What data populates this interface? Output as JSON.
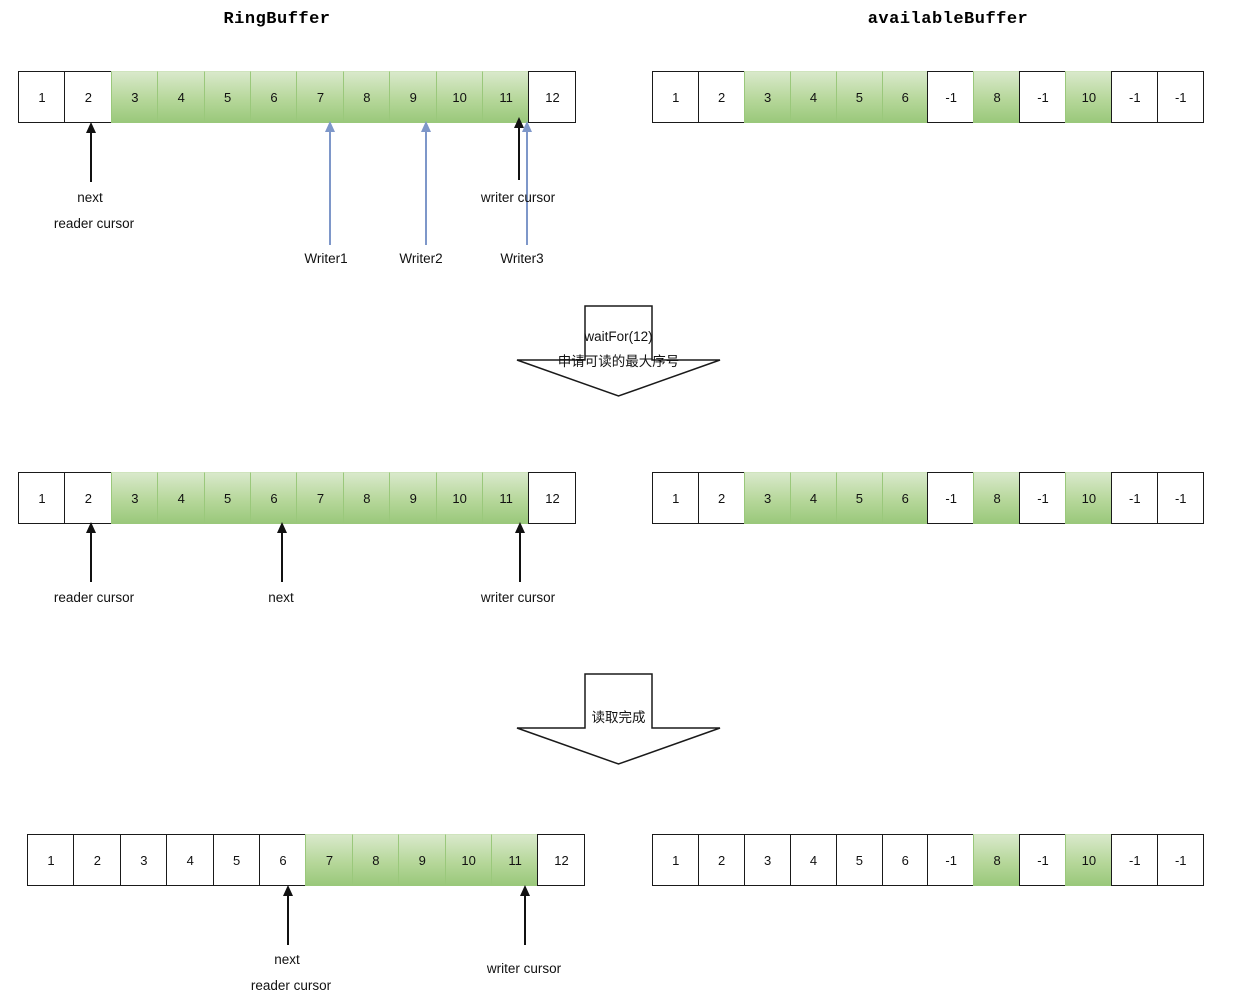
{
  "titles": {
    "ring_buffer": "RingBuffer",
    "available_buffer": "availableBuffer"
  },
  "colors": {
    "filled_cell_top": "#d9e9cb",
    "filled_cell_bottom": "#9ac87b",
    "cell_border": "#1a1a1a",
    "writer_arrow": "#7e97c9",
    "cursor_arrow": "#111111",
    "background": "#ffffff"
  },
  "stages": [
    {
      "id": "stage-1",
      "ring_buffer": {
        "cells": [
          {
            "value": "1",
            "filled": false
          },
          {
            "value": "2",
            "filled": false
          },
          {
            "value": "3",
            "filled": true
          },
          {
            "value": "4",
            "filled": true
          },
          {
            "value": "5",
            "filled": true
          },
          {
            "value": "6",
            "filled": true
          },
          {
            "value": "7",
            "filled": true
          },
          {
            "value": "8",
            "filled": true
          },
          {
            "value": "9",
            "filled": true
          },
          {
            "value": "10",
            "filled": true
          },
          {
            "value": "11",
            "filled": true
          },
          {
            "value": "12",
            "filled": false
          }
        ]
      },
      "available_buffer": {
        "cells": [
          {
            "value": "1",
            "filled": false
          },
          {
            "value": "2",
            "filled": false
          },
          {
            "value": "3",
            "filled": true
          },
          {
            "value": "4",
            "filled": true
          },
          {
            "value": "5",
            "filled": true
          },
          {
            "value": "6",
            "filled": true
          },
          {
            "value": "-1",
            "filled": false
          },
          {
            "value": "8",
            "filled": true
          },
          {
            "value": "-1",
            "filled": false
          },
          {
            "value": "10",
            "filled": true
          },
          {
            "value": "-1",
            "filled": false
          },
          {
            "value": "-1",
            "filled": false
          }
        ]
      },
      "annotations": [
        {
          "name": "next",
          "text": "next",
          "cell_index": 1,
          "kind": "cursor"
        },
        {
          "name": "reader-cursor",
          "text": "reader cursor",
          "cell_index": 1,
          "kind": "cursor"
        },
        {
          "name": "writer-cursor",
          "text": "writer cursor",
          "cell_index": 10,
          "kind": "cursor"
        },
        {
          "name": "writer1",
          "text": "Writer1",
          "cell_index": 6,
          "kind": "writer"
        },
        {
          "name": "writer2",
          "text": "Writer2",
          "cell_index": 8,
          "kind": "writer"
        },
        {
          "name": "writer3",
          "text": "Writer3",
          "cell_index": 10,
          "kind": "writer"
        }
      ]
    },
    {
      "id": "stage-2",
      "ring_buffer": {
        "cells": [
          {
            "value": "1",
            "filled": false
          },
          {
            "value": "2",
            "filled": false
          },
          {
            "value": "3",
            "filled": true
          },
          {
            "value": "4",
            "filled": true
          },
          {
            "value": "5",
            "filled": true
          },
          {
            "value": "6",
            "filled": true
          },
          {
            "value": "7",
            "filled": true
          },
          {
            "value": "8",
            "filled": true
          },
          {
            "value": "9",
            "filled": true
          },
          {
            "value": "10",
            "filled": true
          },
          {
            "value": "11",
            "filled": true
          },
          {
            "value": "12",
            "filled": false
          }
        ]
      },
      "available_buffer": {
        "cells": [
          {
            "value": "1",
            "filled": false
          },
          {
            "value": "2",
            "filled": false
          },
          {
            "value": "3",
            "filled": true
          },
          {
            "value": "4",
            "filled": true
          },
          {
            "value": "5",
            "filled": true
          },
          {
            "value": "6",
            "filled": true
          },
          {
            "value": "-1",
            "filled": false
          },
          {
            "value": "8",
            "filled": true
          },
          {
            "value": "-1",
            "filled": false
          },
          {
            "value": "10",
            "filled": true
          },
          {
            "value": "-1",
            "filled": false
          },
          {
            "value": "-1",
            "filled": false
          }
        ]
      },
      "annotations": [
        {
          "name": "reader-cursor",
          "text": "reader cursor",
          "cell_index": 1,
          "kind": "cursor"
        },
        {
          "name": "next",
          "text": "next",
          "cell_index": 5,
          "kind": "cursor"
        },
        {
          "name": "writer-cursor",
          "text": "writer cursor",
          "cell_index": 10,
          "kind": "cursor"
        }
      ]
    },
    {
      "id": "stage-3",
      "ring_buffer": {
        "cells": [
          {
            "value": "1",
            "filled": false
          },
          {
            "value": "2",
            "filled": false
          },
          {
            "value": "3",
            "filled": false
          },
          {
            "value": "4",
            "filled": false
          },
          {
            "value": "5",
            "filled": false
          },
          {
            "value": "6",
            "filled": false
          },
          {
            "value": "7",
            "filled": true
          },
          {
            "value": "8",
            "filled": true
          },
          {
            "value": "9",
            "filled": true
          },
          {
            "value": "10",
            "filled": true
          },
          {
            "value": "11",
            "filled": true
          },
          {
            "value": "12",
            "filled": false
          }
        ]
      },
      "available_buffer": {
        "cells": [
          {
            "value": "1",
            "filled": false
          },
          {
            "value": "2",
            "filled": false
          },
          {
            "value": "3",
            "filled": false
          },
          {
            "value": "4",
            "filled": false
          },
          {
            "value": "5",
            "filled": false
          },
          {
            "value": "6",
            "filled": false
          },
          {
            "value": "-1",
            "filled": false
          },
          {
            "value": "8",
            "filled": true
          },
          {
            "value": "-1",
            "filled": false
          },
          {
            "value": "10",
            "filled": true
          },
          {
            "value": "-1",
            "filled": false
          },
          {
            "value": "-1",
            "filled": false
          }
        ]
      },
      "annotations": [
        {
          "name": "next",
          "text": "next",
          "cell_index": 5,
          "kind": "cursor"
        },
        {
          "name": "reader-cursor",
          "text": "reader cursor",
          "cell_index": 5,
          "kind": "cursor"
        },
        {
          "name": "writer-cursor",
          "text": "writer cursor",
          "cell_index": 10,
          "kind": "cursor"
        }
      ]
    }
  ],
  "transitions": [
    {
      "id": "transition-1",
      "line1": "waitFor(12)",
      "line2": "申请可读的最大序号"
    },
    {
      "id": "transition-2",
      "line1": "读取完成",
      "line2": ""
    }
  ],
  "stage1_labels": {
    "next": "next",
    "reader_cursor": "reader cursor",
    "writer_cursor": "writer cursor",
    "writer1": "Writer1",
    "writer2": "Writer2",
    "writer3": "Writer3"
  },
  "stage2_labels": {
    "reader_cursor": "reader cursor",
    "next": "next",
    "writer_cursor": "writer cursor"
  },
  "stage3_labels": {
    "next": "next",
    "reader_cursor": "reader cursor",
    "writer_cursor": "writer cursor"
  }
}
